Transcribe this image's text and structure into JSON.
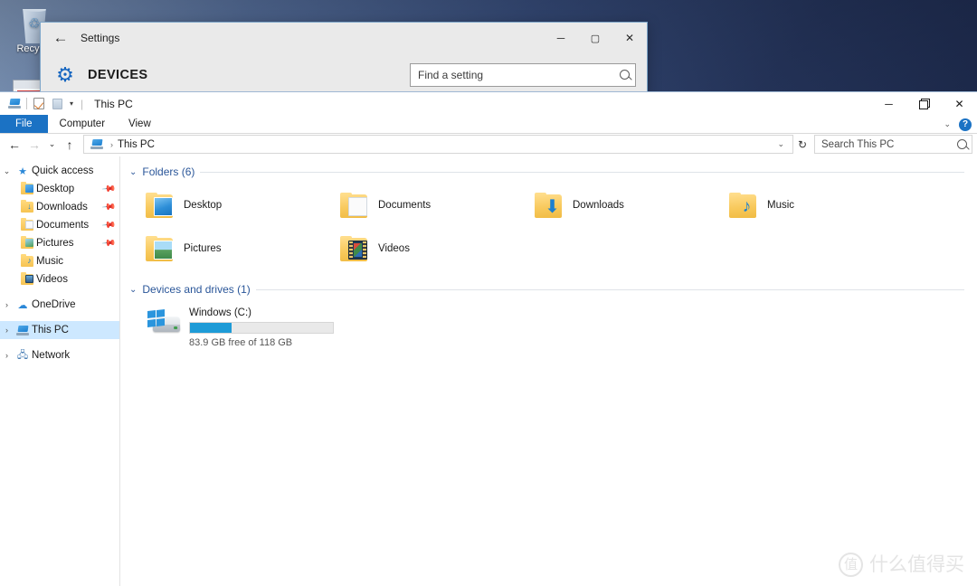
{
  "desktop": {
    "icons": [
      {
        "name": "recycle-bin",
        "label": "Recycle",
        "glyph": "♲"
      }
    ]
  },
  "settings_window": {
    "back_icon": "←",
    "title": "Settings",
    "minimize": "─",
    "maximize": "▢",
    "close": "✕",
    "gear_icon": "⚙",
    "heading": "DEVICES",
    "search": {
      "placeholder": "Find a setting",
      "icon": "search-icon"
    }
  },
  "explorer": {
    "titlebar": {
      "quick_access": [
        {
          "name": "this-pc-icon",
          "label": ""
        },
        {
          "name": "properties-icon",
          "label": ""
        },
        {
          "name": "new-folder-icon",
          "label": ""
        },
        {
          "name": "customize-caret",
          "label": "▾"
        }
      ],
      "separator": "|",
      "title": "This PC",
      "minimize": "─",
      "restore": "❐",
      "close": "✕"
    },
    "ribbon": {
      "tabs": [
        {
          "id": "file",
          "label": "File",
          "active": true
        },
        {
          "id": "computer",
          "label": "Computer",
          "active": false
        },
        {
          "id": "view",
          "label": "View",
          "active": false
        }
      ],
      "collapse_caret": "⌄",
      "help_label": "?"
    },
    "addressbar": {
      "back": "←",
      "forward": "→",
      "recent": "⌄",
      "up": "↑",
      "crumb_icon": "this-pc-icon",
      "crumb_sep": "›",
      "crumb_text": "This PC",
      "crumb_caret": "⌄",
      "refresh": "↻",
      "search_placeholder": "Search This PC",
      "search_icon": "search-icon"
    },
    "sidebar": [
      {
        "id": "quick-access",
        "label": "Quick access",
        "icon": "star-icon",
        "expander": "⌄",
        "expanded": true,
        "indent": false,
        "pinned": false,
        "selected": false
      },
      {
        "id": "desktop",
        "label": "Desktop",
        "icon": "folder-desktop-icon",
        "expander": "",
        "indent": true,
        "pinned": true,
        "selected": false
      },
      {
        "id": "downloads",
        "label": "Downloads",
        "icon": "folder-downloads-icon",
        "expander": "",
        "indent": true,
        "pinned": true,
        "selected": false
      },
      {
        "id": "documents",
        "label": "Documents",
        "icon": "folder-documents-icon",
        "expander": "",
        "indent": true,
        "pinned": true,
        "selected": false
      },
      {
        "id": "pictures",
        "label": "Pictures",
        "icon": "folder-pictures-icon",
        "expander": "",
        "indent": true,
        "pinned": true,
        "selected": false
      },
      {
        "id": "music",
        "label": "Music",
        "icon": "folder-music-icon",
        "expander": "",
        "indent": true,
        "pinned": false,
        "selected": false
      },
      {
        "id": "videos",
        "label": "Videos",
        "icon": "folder-videos-icon",
        "expander": "",
        "indent": true,
        "pinned": false,
        "selected": false
      },
      {
        "id": "onedrive",
        "label": "OneDrive",
        "icon": "cloud-icon",
        "expander": "›",
        "indent": false,
        "pinned": false,
        "selected": false
      },
      {
        "id": "this-pc",
        "label": "This PC",
        "icon": "this-pc-icon",
        "expander": "›",
        "indent": false,
        "pinned": false,
        "selected": true
      },
      {
        "id": "network",
        "label": "Network",
        "icon": "network-icon",
        "expander": "›",
        "indent": false,
        "pinned": false,
        "selected": false
      }
    ],
    "pin_glyph": "📌",
    "sections": [
      {
        "id": "folders",
        "caret": "⌄",
        "title": "Folders (6)"
      },
      {
        "id": "devices",
        "caret": "⌄",
        "title": "Devices and drives (1)"
      }
    ],
    "folders": [
      {
        "id": "desktop",
        "label": "Desktop",
        "icon": "folder-desktop-icon"
      },
      {
        "id": "documents",
        "label": "Documents",
        "icon": "folder-documents-icon"
      },
      {
        "id": "downloads",
        "label": "Downloads",
        "icon": "folder-downloads-icon"
      },
      {
        "id": "music",
        "label": "Music",
        "icon": "folder-music-icon"
      },
      {
        "id": "pictures",
        "label": "Pictures",
        "icon": "folder-pictures-icon"
      },
      {
        "id": "videos",
        "label": "Videos",
        "icon": "folder-videos-icon"
      }
    ],
    "drives": [
      {
        "id": "windows-c",
        "name": "Windows (C:)",
        "free_text": "83.9 GB free of 118 GB",
        "used_percent": 29,
        "bar_color": "#1e9bd7"
      }
    ]
  },
  "watermark": {
    "logo": "值",
    "text": "什么值得买"
  },
  "colors": {
    "accent": "#1b72c4",
    "section_header": "#2a5699",
    "selection": "#cde8ff",
    "drive_bar": "#1e9bd7"
  }
}
